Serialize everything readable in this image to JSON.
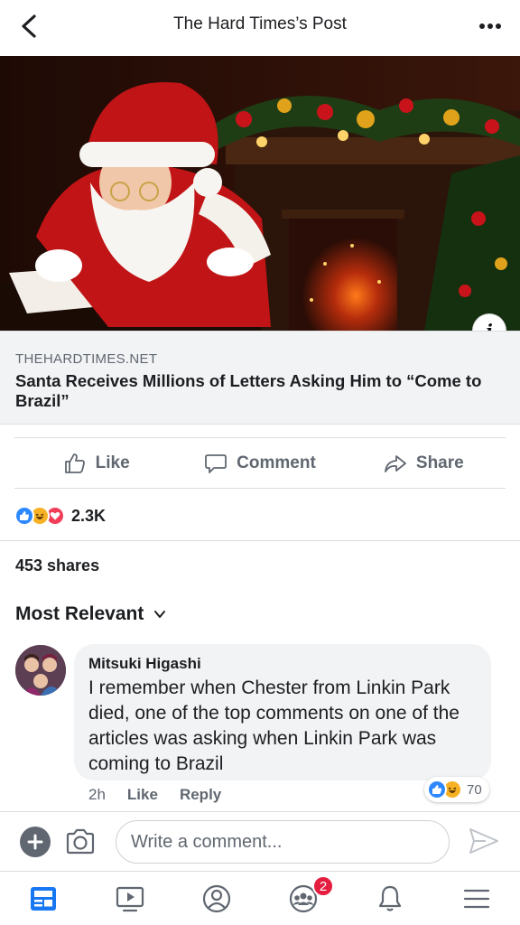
{
  "header": {
    "title": "The Hard Times’s Post"
  },
  "link_preview": {
    "domain": "THEHARDTIMES.NET",
    "title": "Santa Receives Millions of Letters Asking Him to “Come to Brazil”"
  },
  "actions": {
    "like_label": "Like",
    "comment_label": "Comment",
    "share_label": "Share"
  },
  "reactions": {
    "icons": [
      "like-icon",
      "haha-icon",
      "love-icon"
    ],
    "count": "2.3K"
  },
  "shares_text": "453 shares",
  "comments_filter": "Most Relevant",
  "comment": {
    "author": "Mitsuki Higashi",
    "text": "I remember when Chester from Linkin Park died, one of the top comments on one of the articles was asking when Linkin Park was coming to Brazil",
    "time": "2h",
    "like_label": "Like",
    "reply_label": "Reply",
    "reaction_icons": [
      "like-icon",
      "haha-icon"
    ],
    "reaction_count": "70"
  },
  "composer": {
    "placeholder": "Write a comment..."
  },
  "bottom_nav": {
    "items": [
      "news-feed-icon",
      "watch-icon",
      "profile-icon",
      "groups-icon",
      "notifications-icon",
      "menu-icon"
    ],
    "groups_badge": "2"
  },
  "colors": {
    "facebook_blue": "#1877f2",
    "like_blue": "#2d88ff",
    "love_red": "#f33e58",
    "haha_yellow": "#f7b125",
    "badge_red": "#e41e3f"
  }
}
